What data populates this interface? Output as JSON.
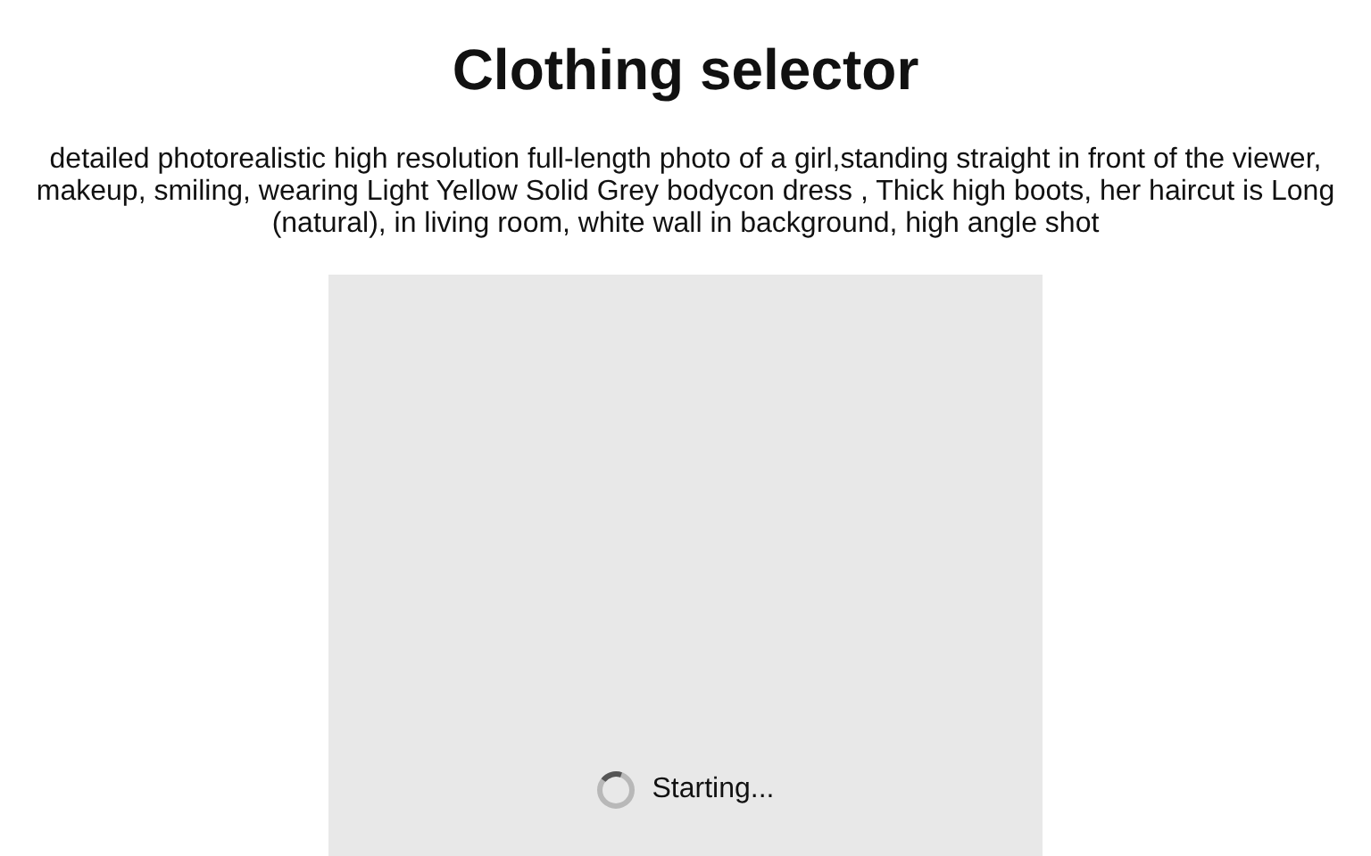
{
  "title": "Clothing selector",
  "prompt": "detailed photorealistic high resolution full-length photo of a girl,standing straight in front of the viewer, makeup, smiling, wearing Light Yellow Solid Grey bodycon dress , Thick high boots, her haircut is Long (natural), in living room, white wall in background, high angle shot",
  "image_panel": {
    "loading": true,
    "status": "Starting..."
  }
}
